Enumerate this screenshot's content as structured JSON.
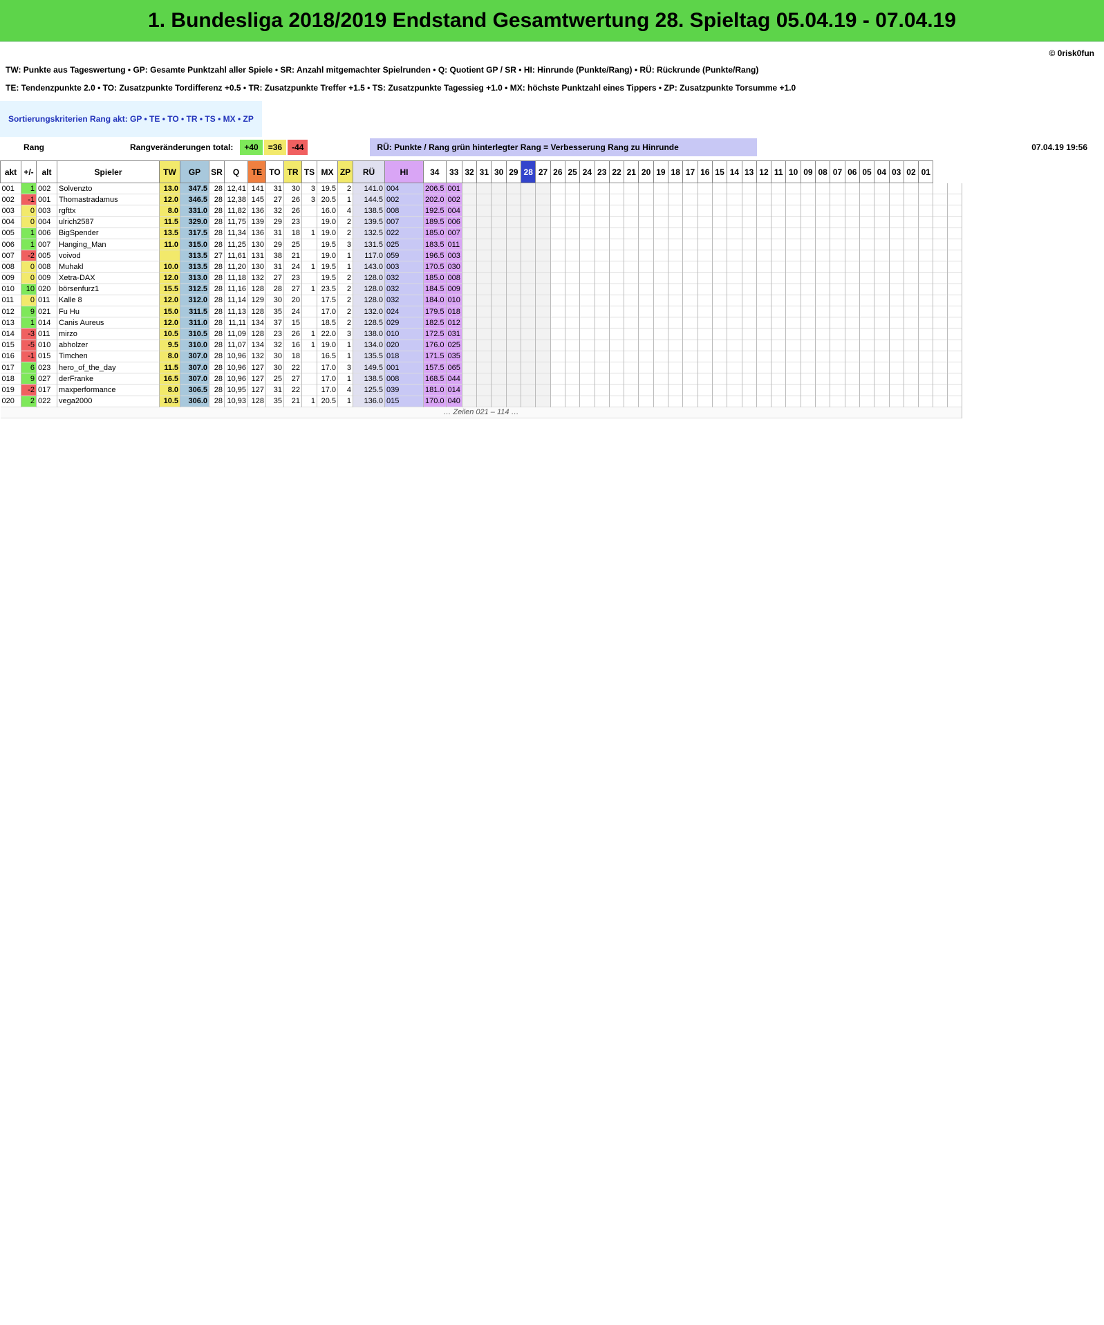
{
  "header": {
    "title": "1. Bundesliga 2018/2019   Endstand Gesamtwertung   28. Spieltag   05.04.19 - 07.04.19",
    "copyright": "© 0risk0fun"
  },
  "legend": {
    "line1": "TW:  Punkte aus Tageswertung   •   GP: Gesamte Punktzahl aller Spiele   •   SR: Anzahl mitgemachter Spielrunden   •   Q: Quotient GP / SR   •   HI: Hinrunde (Punkte/Rang)   •   RÜ: Rückrunde (Punkte/Rang)",
    "line2": "TE:  Tendenzpunkte 2.0   •   TO: Zusatzpunkte Tordifferenz +0.5   •   TR: Zusatzpunkte Treffer +1.5   •   TS: Zusatzpunkte Tagessieg +1.0   •   MX: höchste Punktzahl eines Tippers   •   ZP: Zusatzpunkte Torsumme +1.0"
  },
  "sort": {
    "label": "Sortierungskriterien Rang akt:  GP  •  TE  •  TO  •  TR  •  TS  •  MX  •  ZP"
  },
  "rangbar": {
    "rang": "Rang",
    "changes": "Rangveränderungen total:",
    "plus": "+40",
    "equal": "=36",
    "minus": "-44",
    "rue_info": "RÜ: Punkte / Rang   grün hinterlegter Rang = Verbesserung Rang zu Hinrunde",
    "date": "07.04.19   19:56"
  },
  "colors": {
    "green": "#7ee85a",
    "yellow": "#f2e96b",
    "orange": "#f08040",
    "red": "#f06060",
    "blue": "#3344cc"
  },
  "table": {
    "headers": [
      "akt",
      "+/-",
      "alt",
      "Spieler",
      "TW",
      "GP",
      "SR",
      "Q",
      "TE",
      "TO",
      "TR",
      "TS",
      "MX",
      "ZP",
      "RÜ",
      "HI",
      "34",
      "33",
      "32",
      "31",
      "30",
      "29",
      "28",
      "27",
      "26",
      "25",
      "24",
      "23",
      "22",
      "21",
      "20",
      "19",
      "18",
      "17",
      "16",
      "15",
      "14",
      "13",
      "12",
      "11",
      "10",
      "09",
      "08",
      "07",
      "06",
      "05",
      "04",
      "03",
      "02",
      "01"
    ],
    "rows": [
      [
        "001",
        "1",
        "002",
        "Solvenzto",
        "13.0",
        "347.5",
        "28",
        "12,41",
        "141",
        "31",
        "30",
        "3",
        "19.5",
        "2",
        "141.0",
        "004",
        "206.5",
        "001"
      ],
      [
        "002",
        "-1",
        "001",
        "Thomastradamus",
        "12.0",
        "346.5",
        "28",
        "12,38",
        "145",
        "27",
        "26",
        "3",
        "20.5",
        "1",
        "144.5",
        "002",
        "202.0",
        "002"
      ],
      [
        "003",
        "0",
        "003",
        "rgfttx",
        "8.0",
        "331.0",
        "28",
        "11,82",
        "136",
        "32",
        "26",
        "",
        "16.0",
        "4",
        "138.5",
        "008",
        "192.5",
        "004"
      ],
      [
        "004",
        "0",
        "004",
        "ulrich2587",
        "11.5",
        "329.0",
        "28",
        "11,75",
        "139",
        "29",
        "23",
        "",
        "19.0",
        "2",
        "139.5",
        "007",
        "189.5",
        "006"
      ],
      [
        "005",
        "1",
        "006",
        "BigSpender",
        "13.5",
        "317.5",
        "28",
        "11,34",
        "136",
        "31",
        "18",
        "1",
        "19.0",
        "2",
        "132.5",
        "022",
        "185.0",
        "007"
      ],
      [
        "006",
        "1",
        "007",
        "Hanging_Man",
        "11.0",
        "315.0",
        "28",
        "11,25",
        "130",
        "29",
        "25",
        "",
        "19.5",
        "3",
        "131.5",
        "025",
        "183.5",
        "011"
      ],
      [
        "007",
        "-2",
        "005",
        "voivod",
        "",
        "313.5",
        "27",
        "11,61",
        "131",
        "38",
        "21",
        "",
        "19.0",
        "1",
        "117.0",
        "059",
        "196.5",
        "003"
      ],
      [
        "008",
        "0",
        "008",
        "Muhakl",
        "10.0",
        "313.5",
        "28",
        "11,20",
        "130",
        "31",
        "24",
        "1",
        "19.5",
        "1",
        "143.0",
        "003",
        "170.5",
        "030"
      ],
      [
        "009",
        "0",
        "009",
        "Xetra-DAX",
        "12.0",
        "313.0",
        "28",
        "11,18",
        "132",
        "27",
        "23",
        "",
        "19.5",
        "2",
        "128.0",
        "032",
        "185.0",
        "008"
      ],
      [
        "010",
        "10",
        "020",
        "börsenfurz1",
        "15.5",
        "312.5",
        "28",
        "11,16",
        "128",
        "28",
        "27",
        "1",
        "23.5",
        "2",
        "128.0",
        "032",
        "184.5",
        "009"
      ],
      [
        "011",
        "0",
        "011",
        "Kalle 8",
        "12.0",
        "312.0",
        "28",
        "11,14",
        "129",
        "30",
        "20",
        "",
        "17.5",
        "2",
        "128.0",
        "032",
        "184.0",
        "010"
      ],
      [
        "012",
        "9",
        "021",
        "Fu Hu",
        "15.0",
        "311.5",
        "28",
        "11,13",
        "128",
        "35",
        "24",
        "",
        "17.0",
        "2",
        "132.0",
        "024",
        "179.5",
        "018"
      ],
      [
        "013",
        "1",
        "014",
        "Canis Aureus",
        "12.0",
        "311.0",
        "28",
        "11,11",
        "134",
        "37",
        "15",
        "",
        "18.5",
        "2",
        "128.5",
        "029",
        "182.5",
        "012"
      ],
      [
        "014",
        "-3",
        "011",
        "mirzo",
        "10.5",
        "310.5",
        "28",
        "11,09",
        "128",
        "23",
        "26",
        "1",
        "22.0",
        "3",
        "138.0",
        "010",
        "172.5",
        "031"
      ],
      [
        "015",
        "-5",
        "010",
        "abholzer",
        "9.5",
        "310.0",
        "28",
        "11,07",
        "134",
        "32",
        "16",
        "1",
        "19.0",
        "1",
        "134.0",
        "020",
        "176.0",
        "025"
      ],
      [
        "016",
        "-1",
        "015",
        "Timchen",
        "8.0",
        "307.0",
        "28",
        "10,96",
        "132",
        "30",
        "18",
        "",
        "16.5",
        "1",
        "135.5",
        "018",
        "171.5",
        "035"
      ],
      [
        "017",
        "6",
        "023",
        "hero_of_the_day",
        "11.5",
        "307.0",
        "28",
        "10,96",
        "127",
        "30",
        "22",
        "",
        "17.0",
        "3",
        "149.5",
        "001",
        "157.5",
        "065"
      ],
      [
        "018",
        "9",
        "027",
        "derFranke",
        "16.5",
        "307.0",
        "28",
        "10,96",
        "127",
        "25",
        "27",
        "",
        "17.0",
        "1",
        "138.5",
        "008",
        "168.5",
        "044"
      ],
      [
        "019",
        "-2",
        "017",
        "maxperformance",
        "8.0",
        "306.5",
        "28",
        "10,95",
        "127",
        "31",
        "22",
        "",
        "17.0",
        "4",
        "125.5",
        "039",
        "181.0",
        "014"
      ],
      [
        "020",
        "2",
        "022",
        "vega2000",
        "10.5",
        "306.0",
        "28",
        "10,93",
        "128",
        "35",
        "21",
        "1",
        "20.5",
        "1",
        "136.0",
        "015",
        "170.0",
        "040"
      ]
    ],
    "more": "… Zeilen 021 – 114 …"
  }
}
